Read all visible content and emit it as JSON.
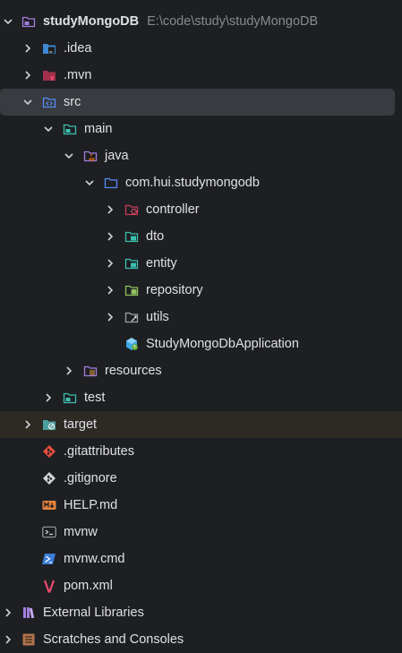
{
  "project": {
    "name": "studyMongoDB",
    "path": "E:\\code\\study\\studyMongoDB"
  },
  "items": {
    "idea": ".idea",
    "mvn": ".mvn",
    "src": "src",
    "main": "main",
    "java": "java",
    "package": "com.hui.studymongodb",
    "controller": "controller",
    "dto": "dto",
    "entity": "entity",
    "repository": "repository",
    "utils": "utils",
    "application": "StudyMongoDbApplication",
    "resources": "resources",
    "test": "test",
    "target": "target",
    "gitattributes": ".gitattributes",
    "gitignore": ".gitignore",
    "help": "HELP.md",
    "mvnw": "mvnw",
    "mvnw_cmd": "mvnw.cmd",
    "pom": "pom.xml",
    "external_libraries": "External Libraries",
    "scratches": "Scratches and Consoles"
  },
  "icons": {
    "chevron-right": "chevron-right-icon",
    "chevron-down": "chevron-down-icon",
    "folder": "folder-icon",
    "module": "module-folder-icon",
    "source-root": "source-root-icon",
    "package": "package-icon",
    "spring-class": "spring-boot-class-icon",
    "git": "git-icon",
    "markdown": "markdown-icon",
    "terminal": "terminal-icon",
    "powershell": "powershell-icon",
    "maven": "maven-icon",
    "library": "library-icon",
    "scratches": "scratches-icon"
  },
  "colors": {
    "background": "#1e1f22",
    "selection": "#393b40",
    "excluded_row": "#2d2a24",
    "text": "#dfe1e5",
    "muted": "#868a91",
    "folder_blue": "#548af7",
    "folder_teal": "#3bbfb0",
    "maven_red": "#c93c5b"
  }
}
